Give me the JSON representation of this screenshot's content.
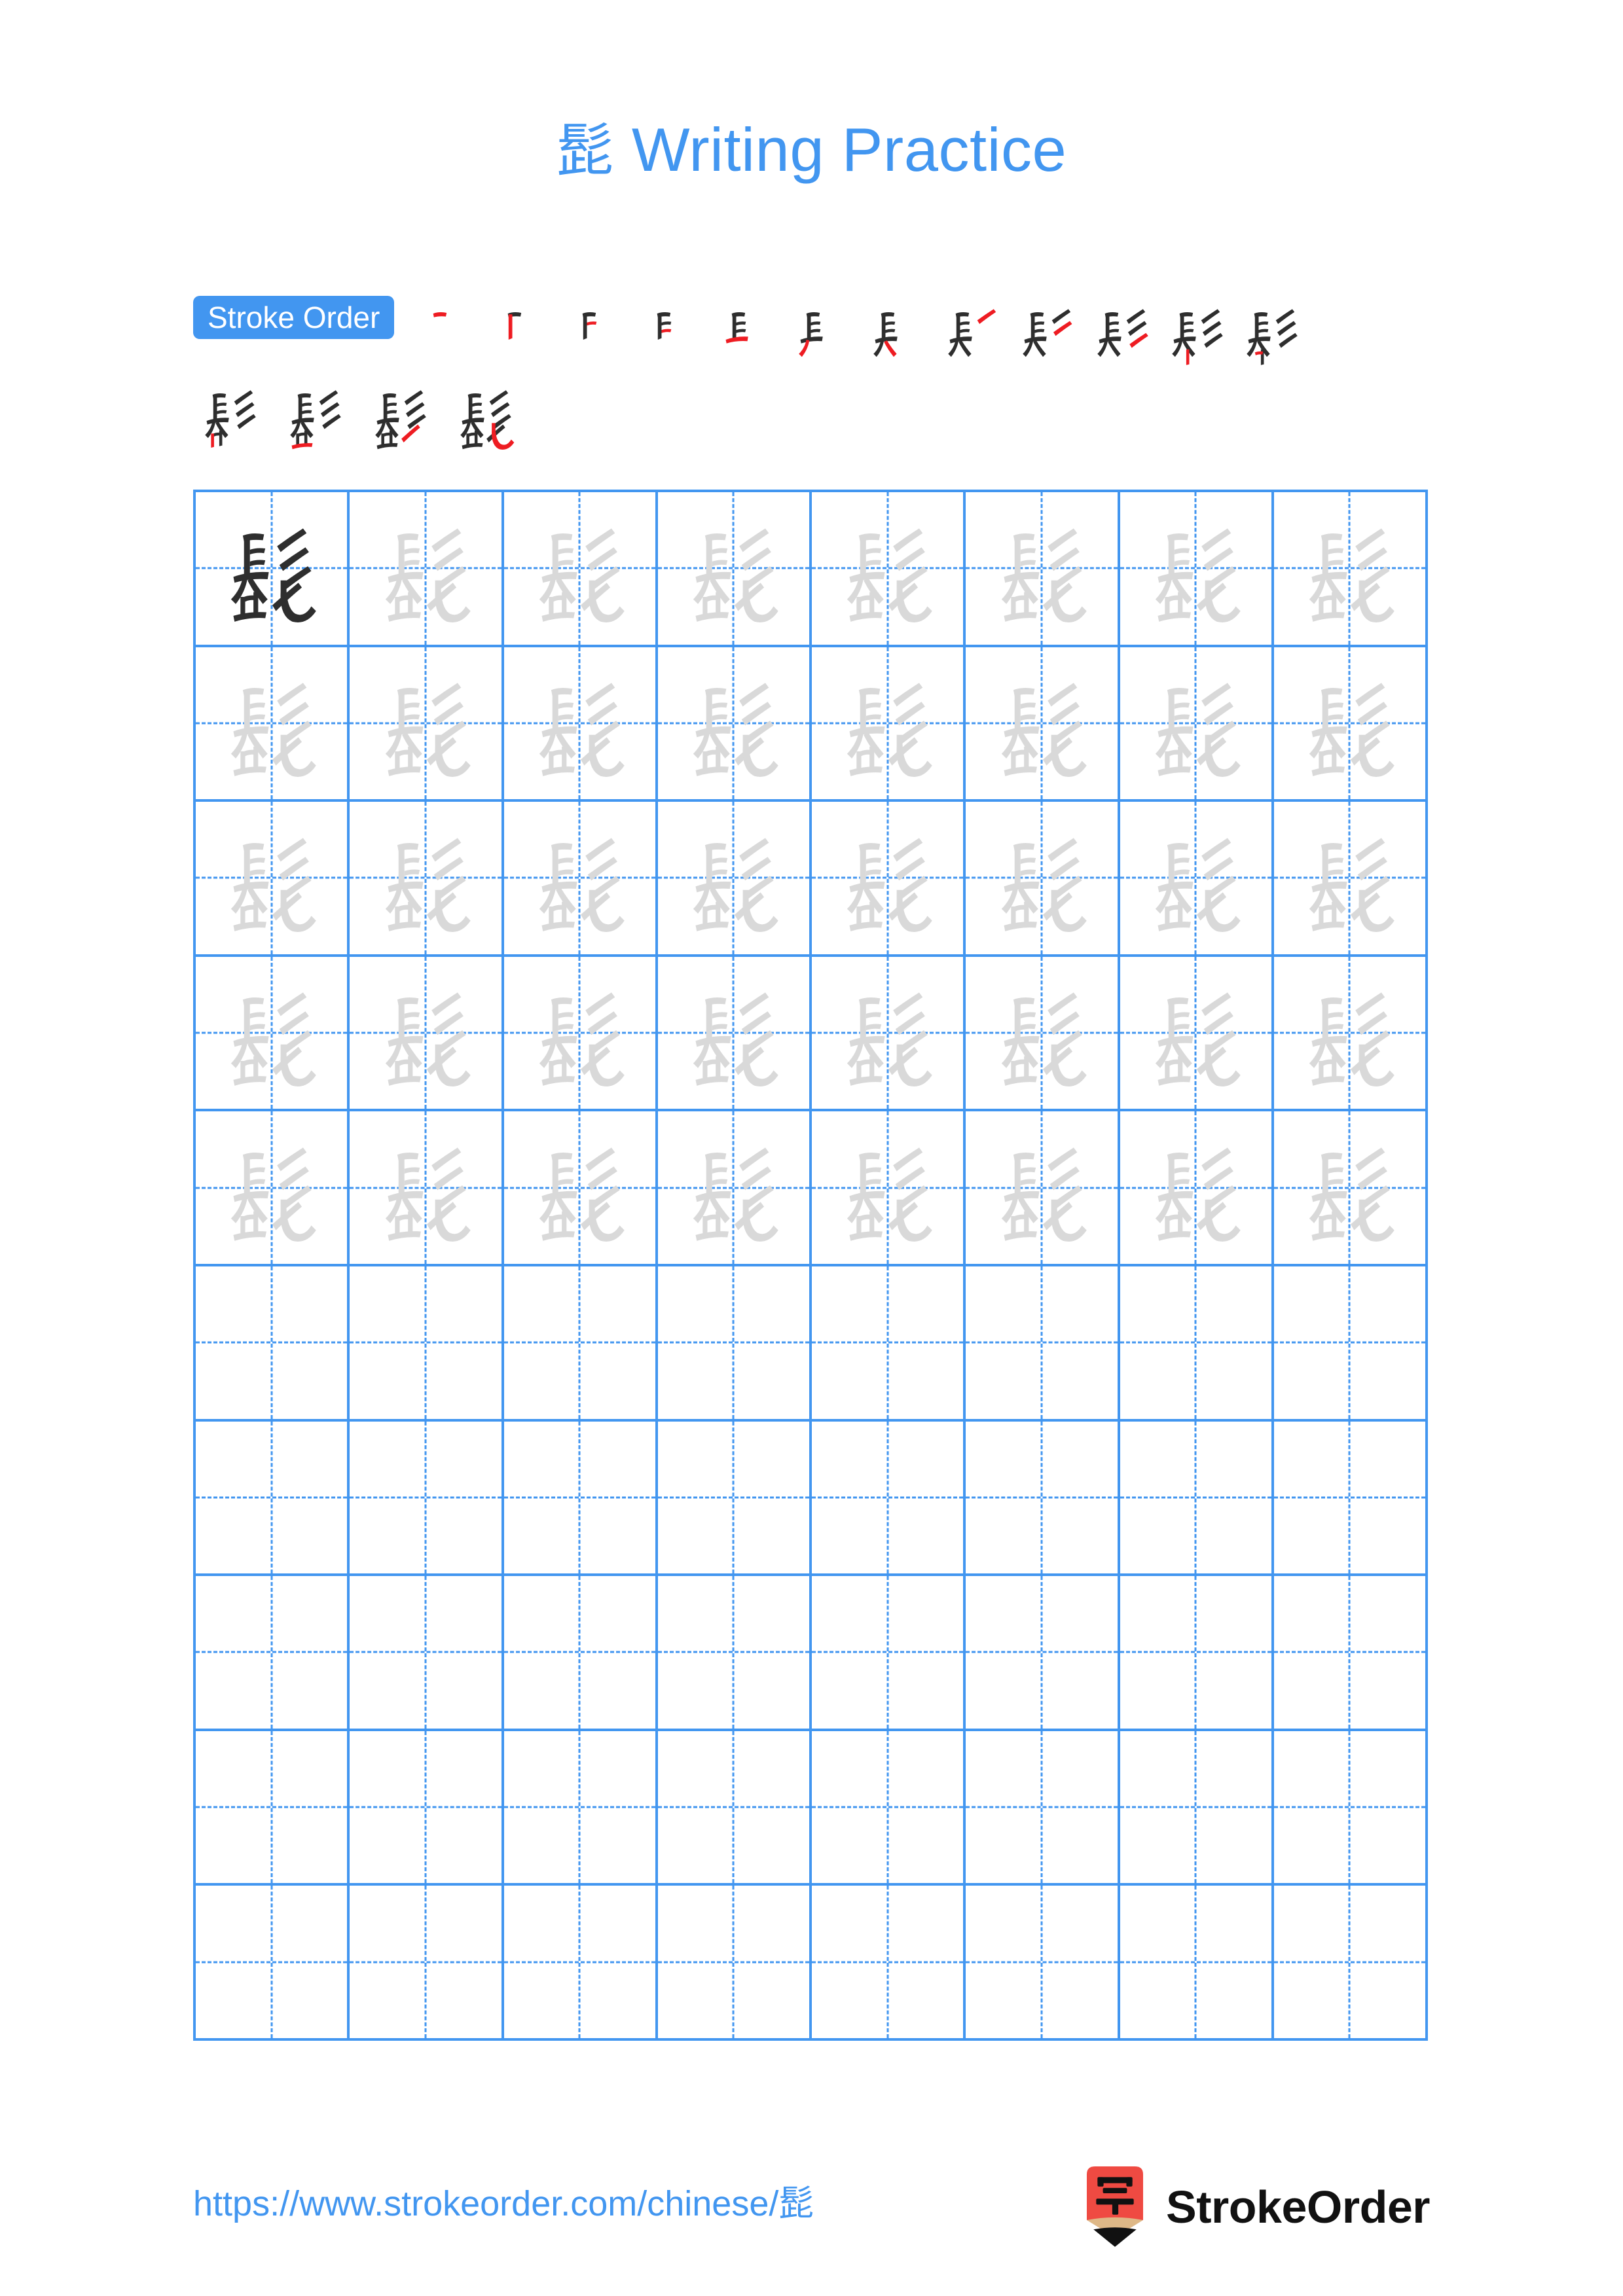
{
  "page": {
    "character": "髭",
    "background_color": "#ffffff",
    "accent_color": "#4296F0",
    "ink_dark_color": "#2E2E2E",
    "ink_light_color": "#D9D9D9",
    "highlight_stroke_color": "#EE1C22"
  },
  "header": {
    "title_character": "髭",
    "title_text": " Writing Practice"
  },
  "stroke_order": {
    "badge_label": "Stroke Order",
    "total_strokes": 16,
    "row1_count": 12,
    "row2_count": 4,
    "steps": [
      {
        "index": 1,
        "strokes_shown": 1
      },
      {
        "index": 2,
        "strokes_shown": 2
      },
      {
        "index": 3,
        "strokes_shown": 3
      },
      {
        "index": 4,
        "strokes_shown": 4
      },
      {
        "index": 5,
        "strokes_shown": 5
      },
      {
        "index": 6,
        "strokes_shown": 6
      },
      {
        "index": 7,
        "strokes_shown": 7
      },
      {
        "index": 8,
        "strokes_shown": 8
      },
      {
        "index": 9,
        "strokes_shown": 9
      },
      {
        "index": 10,
        "strokes_shown": 10
      },
      {
        "index": 11,
        "strokes_shown": 11
      },
      {
        "index": 12,
        "strokes_shown": 12
      },
      {
        "index": 13,
        "strokes_shown": 13
      },
      {
        "index": 14,
        "strokes_shown": 14
      },
      {
        "index": 15,
        "strokes_shown": 15
      },
      {
        "index": 16,
        "strokes_shown": 16
      }
    ]
  },
  "practice_grid": {
    "columns": 8,
    "rows": 10,
    "filled_rows": 5,
    "empty_rows": 5,
    "dark_cells": 1,
    "guide_style": "dashed-cross"
  },
  "footer": {
    "url": "https://www.strokeorder.com/chinese/髭",
    "brand_name": "StrokeOrder",
    "logo_character": "字",
    "logo_body_color": "#EF4A42",
    "logo_wood_color": "#DEB887",
    "logo_tip_color": "#111111"
  }
}
